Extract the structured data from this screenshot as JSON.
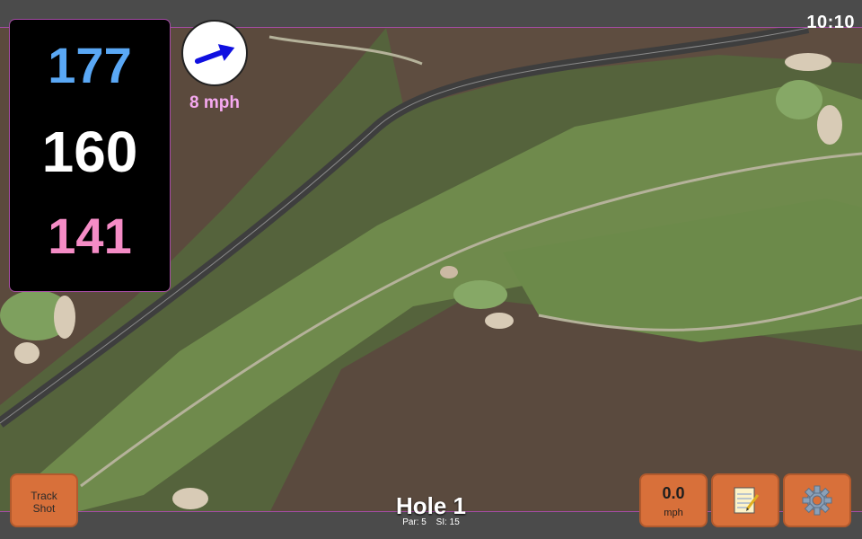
{
  "status": {
    "time": "10:10"
  },
  "yardages": {
    "back": "177",
    "center": "160",
    "front": "141"
  },
  "wind": {
    "speed_label": "8 mph",
    "icon": "wind-arrow-icon",
    "arrow_color": "#1010e0"
  },
  "hole": {
    "title": "Hole 1",
    "par_label": "Par: 5",
    "si_label": "SI: 15"
  },
  "buttons": {
    "track_line1": "Track",
    "track_line2": "Shot",
    "speed_value": "0.0",
    "speed_unit": "mph",
    "notes_icon": "notepad-icon",
    "settings_icon": "gear-icon"
  },
  "colors": {
    "back": "#5aa8f5",
    "center": "#ffffff",
    "front": "#f58cc6",
    "button": "#d8703a",
    "accent": "#a64ca6"
  }
}
